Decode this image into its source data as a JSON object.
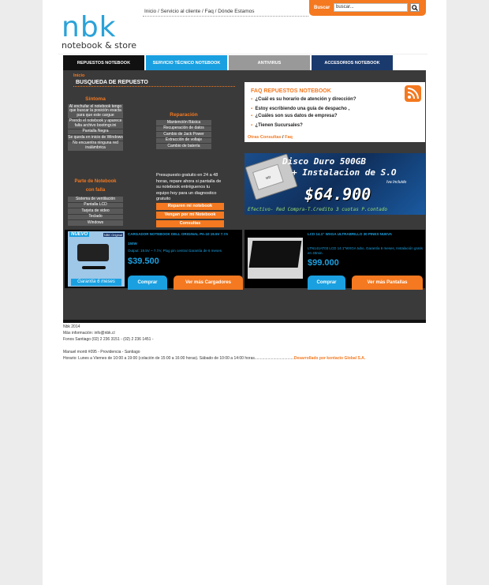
{
  "logo": {
    "brand": "nbk",
    "tagline": "notebook & store"
  },
  "topnav": {
    "links": [
      "Inicio",
      "Servicio al cliente",
      "Faq",
      "Dónde Estamos"
    ],
    "sep": " / "
  },
  "search": {
    "label": "Buscar",
    "value": "buscar..."
  },
  "tabs": [
    {
      "label": "REPUESTOS NOTEBOOK",
      "color": "#111111"
    },
    {
      "label": "SERVICIO TÉCNICO NOTEBOOK",
      "color": "#1aa0e0"
    },
    {
      "label": "ANTIVIRUS",
      "color": "#999999"
    },
    {
      "label": "ACCESORIOS NOTEBOOK",
      "color": "#1a3a6e"
    }
  ],
  "breadcrumb": "Inicio",
  "section_title": "BUSQUEDA DE REPUESTO",
  "sintoma": {
    "title": "Síntoma",
    "items": [
      "Al enchufar el notebook tengo que buscar la posición exacta para que este cargue",
      "Prendo el notebook y aparece falta archivo bootmgr.ini",
      "Pantalla Negra",
      "Se queda en inicio de Windows",
      "No encuentra ninguna red inalámbrica"
    ]
  },
  "partes": {
    "title_1": "Parte de Notebook",
    "title_2": "con falla",
    "items": [
      "Sistema de ventilación",
      "Pantalla LCD",
      "Tarjeta de video",
      "Teclado",
      "Windows"
    ]
  },
  "reparacion": {
    "title": "Reparación",
    "items": [
      "Mantención Básica",
      "Recuperación de datos",
      "Cambio de Jack Power",
      "Extracción de voltaje",
      "Cambio de batería"
    ]
  },
  "presupuesto": {
    "text": "Presupuesto gratuito en 24 a 48 horas, repare ahora si pantalla de su notebook entréguenos tu equipo hoy para un diagnostico gratuito",
    "buttons": [
      "Reparen mi notebook",
      "Vengan por mi Notebook",
      "Consultas"
    ]
  },
  "faq": {
    "title": "FAQ REPUESTOS NOTEBOOK",
    "items": [
      "¿Cuál es su horario de atención y dirección?",
      "Estoy escribiendo una guía de despacho ,",
      "¿Cuáles son sus datos de empresa?",
      "¿Tienen Sucursales?"
    ],
    "footer_link_1": "Otras Consultas",
    "footer_link_2": "Faq"
  },
  "banner": {
    "line1": "Disco Duro 500GB",
    "line2": "+ Instalacion de S.O",
    "iva": "Iva Incluido",
    "price": "$64.900",
    "payment": "Efectivo- Red Compra-T.Credito 3 cuotas P.contado",
    "disk_label": "WD"
  },
  "product1": {
    "badge": "NUEVO",
    "badge2": "NBK Original",
    "title": "CARGADOR NOTEBOOK DELL ORIGINAL PA-10 19.5V 7.7A",
    "subtitle": "150W",
    "desc": "Output: 19.5V ~ 7.7A; Plug pin central Garantía de 6 meses",
    "price": "$39.500",
    "garantia": "Garantía 6 meses",
    "buy": "Comprar",
    "more": "Ver más Cargadores"
  },
  "product2": {
    "title": "LCD 14.1\" WXGA ULTRABRILLO 30 PINES NUEVA",
    "desc": "LTN141AT03 LCD 14.1\"WXGA tubo, Garantía 6 meses, Instalación gratis en 40min.",
    "price": "$99.000",
    "buy": "Comprar",
    "more": "Ver más Pantallas"
  },
  "footer": {
    "l1": "Nbk 2014",
    "l2": "Más información: info@nbk.cl",
    "l3": "Fonos Santiago (02) 2 236 3151 - (02) 2 236 1451 -",
    "l4": "Manuel montt #095 - Providencia - Santiago",
    "l5": "Horario: Lunes a Viernes de 10:00 a 19:00 (colación de 15:00 a 16:00 horas). Sábado de 10:00 a 14:00 horas....................................",
    "credit": "Desarrollado por kontacto Global S.A."
  }
}
